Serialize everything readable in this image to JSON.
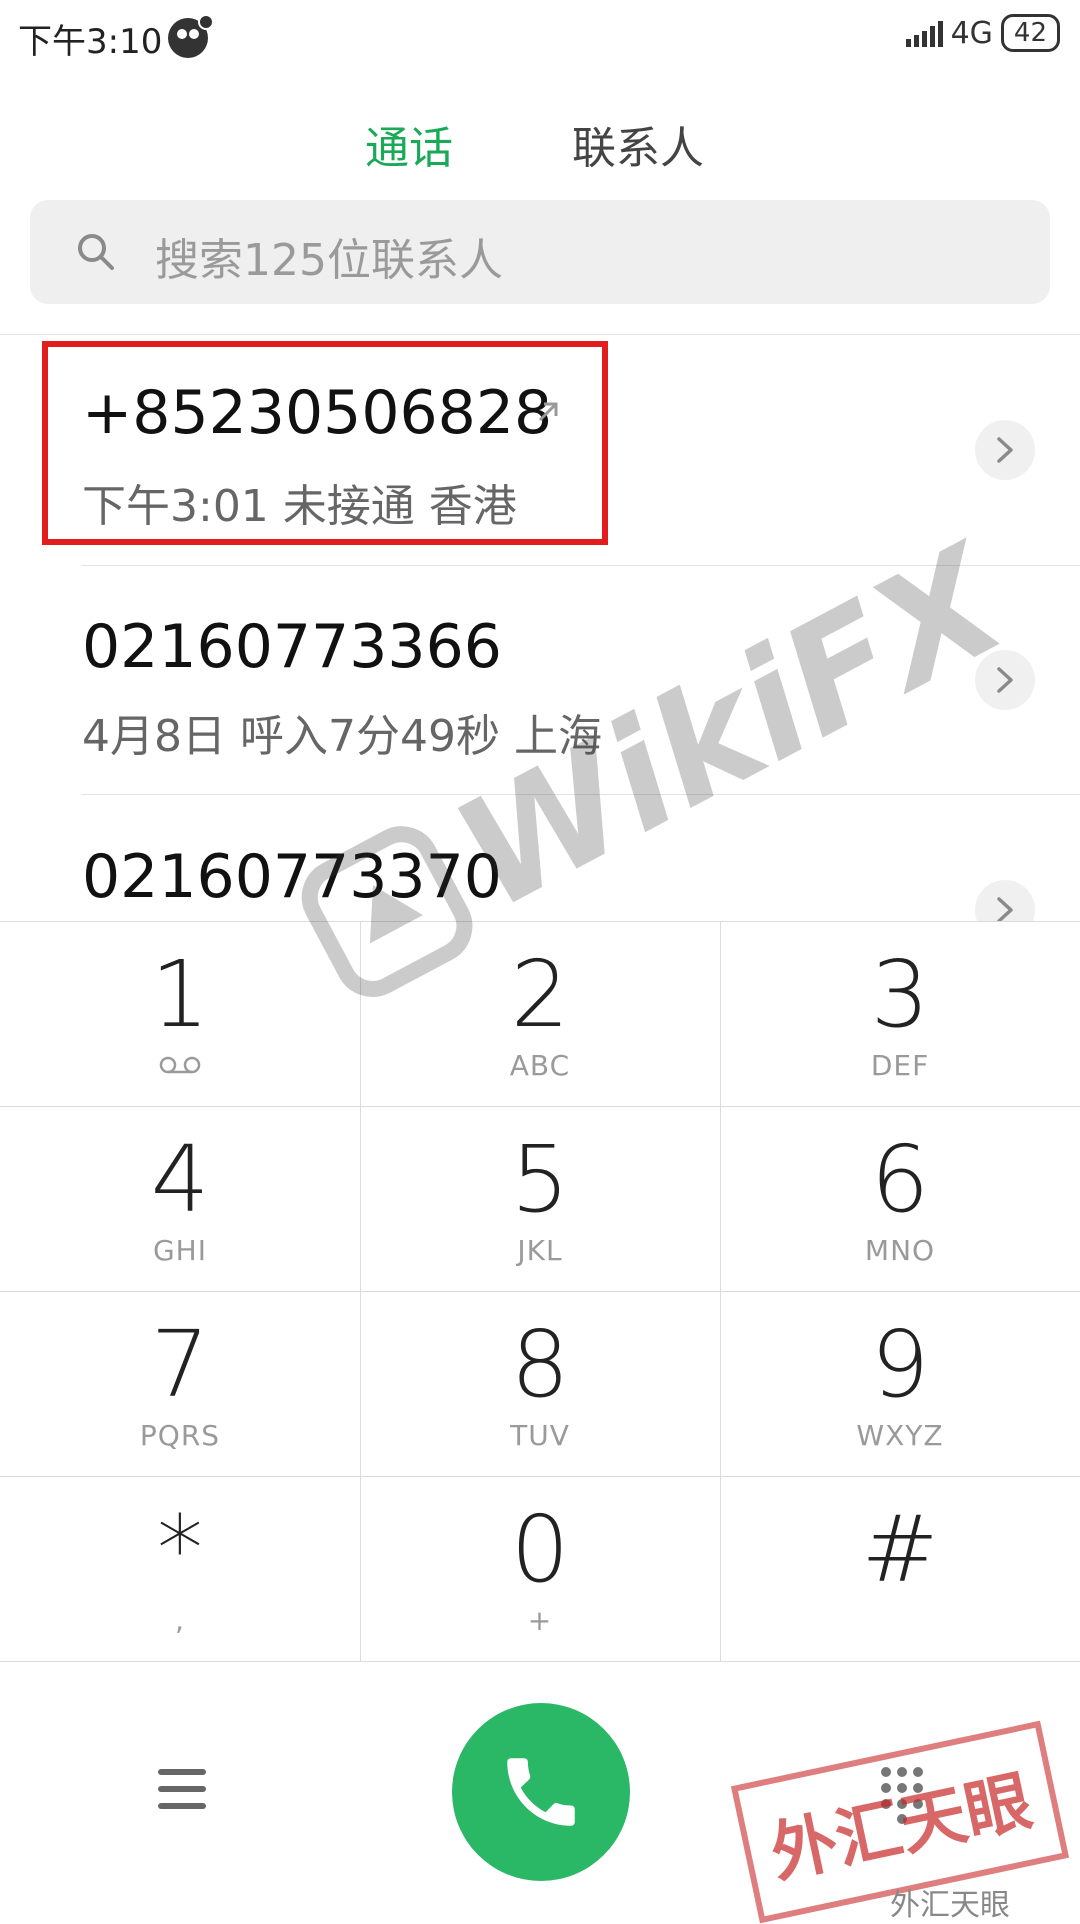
{
  "status_bar": {
    "time": "下午3:10",
    "network": "4G",
    "battery": "42"
  },
  "tabs": {
    "calls": "通话",
    "contacts": "联系人",
    "active": "通话"
  },
  "search": {
    "placeholder": "搜索125位联系人"
  },
  "calls": [
    {
      "number": "+85230506828",
      "detail": "下午3:01 未接通 香港",
      "outgoing": true,
      "highlighted": true
    },
    {
      "number": "02160773366",
      "detail": "4月8日 呼入7分49秒 上海"
    },
    {
      "number": "02160773370"
    }
  ],
  "keypad": [
    {
      "digit": "1",
      "letters": ""
    },
    {
      "digit": "2",
      "letters": "ABC"
    },
    {
      "digit": "3",
      "letters": "DEF"
    },
    {
      "digit": "4",
      "letters": "GHI"
    },
    {
      "digit": "5",
      "letters": "JKL"
    },
    {
      "digit": "6",
      "letters": "MNO"
    },
    {
      "digit": "7",
      "letters": "PQRS"
    },
    {
      "digit": "8",
      "letters": "TUV"
    },
    {
      "digit": "9",
      "letters": "WXYZ"
    },
    {
      "digit": "*",
      "letters": ","
    },
    {
      "digit": "0",
      "letters": "+"
    },
    {
      "digit": "#",
      "letters": ""
    }
  ],
  "watermarks": {
    "logo_text": "WikiFX",
    "stamp_text": "外汇天眼",
    "credit": "外汇天眼"
  },
  "colors": {
    "accent_green": "#1aaa57",
    "call_green": "#2ab866",
    "highlight_red": "#e11d1d"
  },
  "icons": [
    "search-icon",
    "outgoing-call-icon",
    "chevron-right-icon",
    "menu-icon",
    "phone-icon",
    "dialpad-icon",
    "voicemail-icon"
  ]
}
